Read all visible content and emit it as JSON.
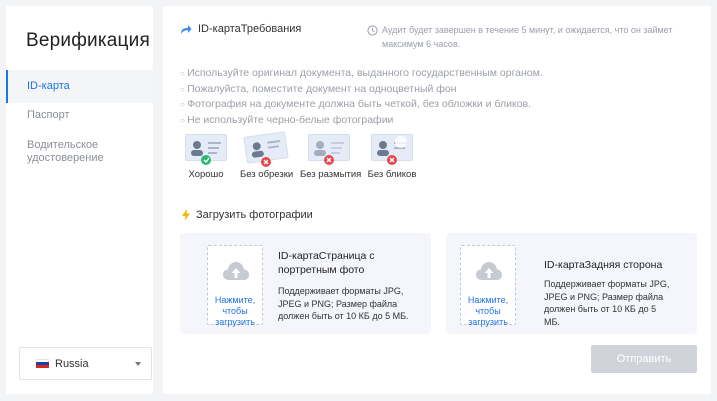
{
  "sidebar": {
    "title": "Верификация",
    "items": [
      {
        "label": "ID-карта",
        "active": true
      },
      {
        "label": "Паспорт",
        "active": false
      },
      {
        "label": "Водительское удостоверение",
        "active": false
      }
    ],
    "country": {
      "value": "Russia",
      "flag_colors": [
        "#ffffff",
        "#1c3fa8",
        "#d52b1e"
      ]
    }
  },
  "main": {
    "requirements_title": "ID-картаТребования",
    "audit_text": "Аудит будет завершен в течение 5 минут, и ожидается, что он займет максимум 6 часов.",
    "rules": [
      "Используйте оригинал документа, выданного государственным органом.",
      "Пожалуйста, поместите документ на одноцветный фон",
      "Фотография на документе должна быть четкой, без обложки и бликов.",
      "Не используйте черно-белые фотографии"
    ],
    "examples": [
      {
        "label": "Хорошо",
        "status": "ok"
      },
      {
        "label": "Без обрезки",
        "status": "bad"
      },
      {
        "label": "Без размытия",
        "status": "bad"
      },
      {
        "label": "Без бликов",
        "status": "bad"
      }
    ],
    "upload_title": "Загрузить фотографии",
    "cards": [
      {
        "dropzone_text": "Нажмите, чтобы загрузить",
        "title": "ID-картаСтраница с портретным фото",
        "desc": "Поддерживает форматы JPG, JPEG и PNG; Размер файла должен быть от 10 КБ до 5 МБ."
      },
      {
        "dropzone_text": "Нажмите, чтобы загрузить",
        "title": "ID-картаЗадняя сторона",
        "desc": "Поддерживает форматы JPG, JPEG и PNG; Размер файла должен быть от 10 КБ до 5 МБ."
      }
    ],
    "submit_label": "Отправить"
  },
  "colors": {
    "accent": "#1e73e8",
    "ok": "#2bb673",
    "error": "#e5484d",
    "submit_disabled": "#d0d4da",
    "icon_arrow": "#3b8bea",
    "icon_bolt": "#f5b800"
  },
  "icons": [
    "arrow-icon",
    "clock-icon",
    "lightning-icon",
    "upload-cloud-icon",
    "check-icon",
    "cross-icon",
    "chevron-down-icon"
  ]
}
